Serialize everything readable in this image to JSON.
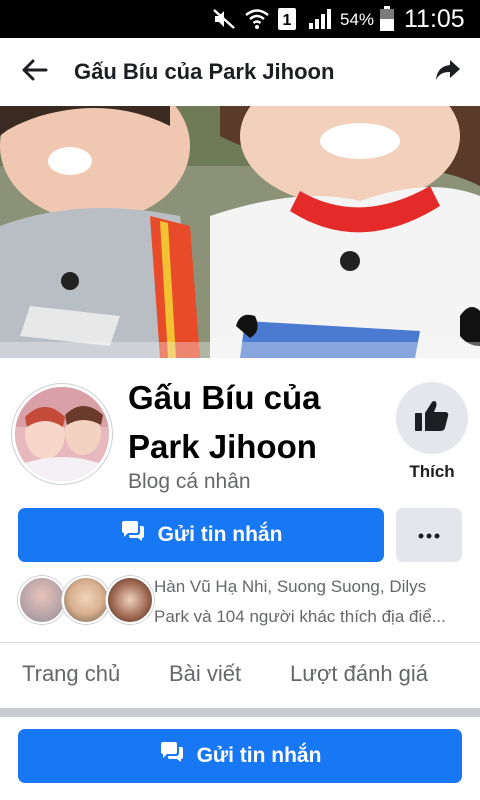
{
  "status_bar": {
    "battery_percent": "54%",
    "time": "11:05",
    "sim_slot": "1",
    "icons": [
      "mute-icon",
      "wifi-icon",
      "sim-1-icon",
      "signal-icon",
      "battery-icon"
    ]
  },
  "header": {
    "title": "Gấu Bíu của Park Jihoon",
    "back_icon": "arrow-left-icon",
    "share_icon": "share-arrow-icon"
  },
  "profile": {
    "name": "Gấu Bíu của Park Jihoon",
    "category": "Blog cá nhân",
    "like_label": "Thích",
    "message_label": "Gửi tin nhắn",
    "more_icon": "ellipsis-icon"
  },
  "friends": {
    "line1_parts": [
      "Hàn Vũ Hạ Nhi",
      "Suong Suong",
      "Dilys"
    ],
    "line2": "Park và 104 người khác thích địa điể..."
  },
  "tabs": [
    "Trang chủ",
    "Bài viết",
    "Lượt đánh giá"
  ],
  "bottom_bar": {
    "message_label": "Gửi tin nhắn"
  },
  "colors": {
    "accent": "#1877f2",
    "secondary_button": "#e4e6eb",
    "text_primary": "#1c1e21",
    "text_secondary": "#65676b"
  }
}
